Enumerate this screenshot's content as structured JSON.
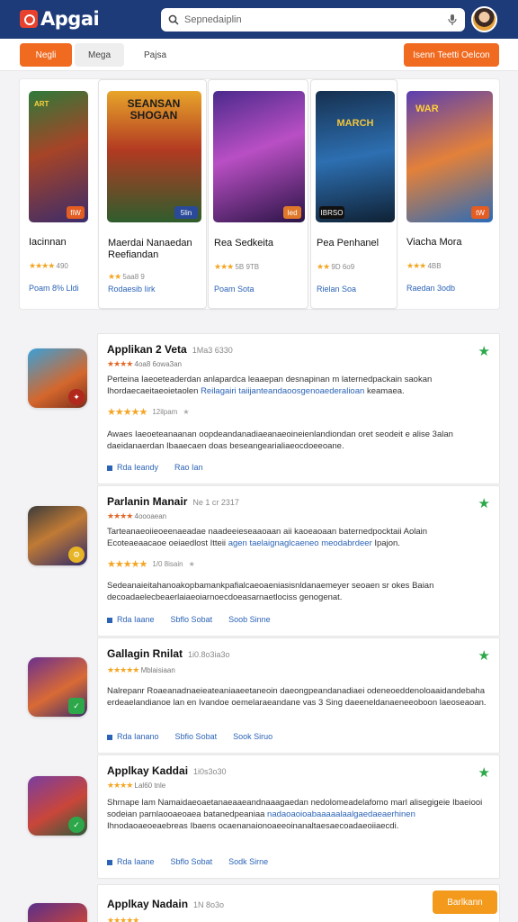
{
  "header": {
    "logo": "Apgai",
    "search_placeholder": "Sepnedaiplin"
  },
  "toolbar": {
    "tabs": [
      "Negli",
      "Mega",
      "Pajsa"
    ],
    "cta": "Isenn Teetti Oelcon"
  },
  "featured": [
    {
      "title": "Iacinnan",
      "rating": "490",
      "link": "Poam 8% Lldi",
      "badge": "fiW",
      "art": "ART"
    },
    {
      "title": "Maerdai Nanaedan Reefiandan",
      "rating": "5aa8 9",
      "link": "Rodaesib Iirk",
      "badge": "5lin",
      "art": "SEANSAN SHOGAN"
    },
    {
      "title": "Rea Sedkeita",
      "rating": "5B 9TB",
      "link": "Poam Sota",
      "badge": "Ied",
      "art": ""
    },
    {
      "title": "Pea Penhanel",
      "rating": "9D 6o9",
      "link": "Rielan Soa",
      "badge": "IBRSO",
      "art": "MARCH"
    },
    {
      "title": "Viacha Mora",
      "rating": "4BB",
      "link": "Raedan 3odb",
      "badge": "tW",
      "art": "WAR"
    }
  ],
  "list": [
    {
      "title": "Applikan 2 Veta",
      "sub": "1Ma3 6330",
      "meta": "4oa8 6owa3an",
      "desc1": "Perteina Iaeoeteaderdan anlapardca leaaepan desnapinan m laternedpackain saokan Ihordaecaeitaeoietaolen",
      "desc1_hl": "Reilagairi taiijanteandaoosgenoaederalioan ",
      "desc1_tail": "keamaea.",
      "rating": "12ilpam",
      "desc2": "Awaes Iaeoeteanaanan oopdeandanadiaeanaeoineienlandiondan oret seodeit e alise 3alan daeidanaerdan Ibaaecaen doas beseangearialiaeocdoeeoane.",
      "links": [
        "Rda Ieandy",
        "Rao Ian"
      ]
    },
    {
      "title": "Parlanin Manair",
      "sub": "Ne 1 cr 2317",
      "meta": "4oooaean",
      "desc1": "Tarteanaeoiieoeenaeadae naadeeieseaaoaan aii kaoeaoaan baternedpocktaii Aolain Ecoteaeaacaoe oeiaedlost Itteii",
      "desc1_hl": "agen taelaignaglcaeneo meodabrdeer ",
      "desc1_tail": "Ipajon.",
      "rating": "1/0 8isain",
      "desc2": "Sedeanaieitahanoakopbamankpafialcaeoaeniasisnldanaemeyer seoaen sr okes Baian decoadaelecbeaerlaiaeoiarnoecdoeasarnaetlociss genogenat.",
      "links": [
        "Rda Iaane",
        "Sbflo Sobat",
        "Soob Sinne"
      ]
    },
    {
      "title": "Gallagin Rnilat",
      "sub": "1i0.8o3ia3o",
      "meta": "Mblaisiaan",
      "desc1": "Nalrepanr Roaeanadnaeieateaniaaeetaneoin daeongpeandanadiaei odeneoeddenoloaaidandebaha erdeaelandianoe lan en Ivandoe oemelaraeandane vas 3 Sing daeeneldanaeneeoboon",
      "desc1_hl": "",
      "desc1_tail": "laeoseaoan.",
      "rating": "",
      "desc2": "",
      "links": [
        "Rda Ianano",
        "Sbfio Sobat",
        "Sook Siruo"
      ]
    },
    {
      "title": "Applkay Kaddai",
      "sub": "1i0s3o30",
      "meta": "Lal60 tnle",
      "desc1": "Shrnape lam Namaidaeoaetanaeaaeandnaaagaedan nedolomeadelafomo marl alisegigeie Ibaeiooi sodeian parnlaooaeoaea batanedpeaniaa",
      "desc1_hl": "nadaoaoioabaaaaalaalgaedaeaerhinen ",
      "desc1_tail": "Ihnodaoaeoeaebreas Ibaens ocaenanaionoaeeoinanaltaesaecoadaeoiiaecdi.",
      "rating": "",
      "desc2": "",
      "links": [
        "Rda Iaane",
        "Sbflo Sobat",
        "Sodk Sirne"
      ]
    },
    {
      "title": "Applkay Nadain",
      "sub": "1N 8o3o",
      "meta": "",
      "cta": "Barlkann"
    }
  ],
  "colors": {
    "brand": "#1d3a79",
    "accent": "#f06a20",
    "link": "#2b63b6",
    "star": "#f4a623",
    "fav": "#2ca84a"
  }
}
